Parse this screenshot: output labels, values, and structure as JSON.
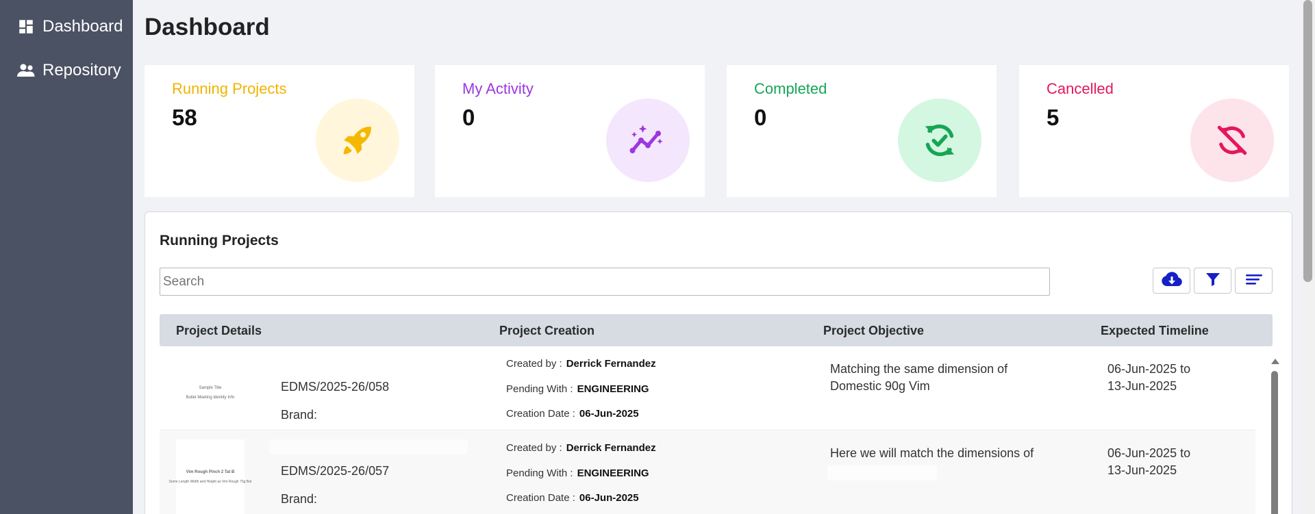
{
  "sidebar": {
    "items": [
      {
        "label": "Dashboard",
        "icon": "dashboard-icon"
      },
      {
        "label": "Repository",
        "icon": "people-icon"
      }
    ]
  },
  "page": {
    "title": "Dashboard"
  },
  "cards": [
    {
      "label": "Running Projects",
      "value": "58",
      "color": "#f0b400",
      "bg": "#fff6dc",
      "icon": "rocket-icon"
    },
    {
      "label": "My Activity",
      "value": "0",
      "color": "#9b37e0",
      "bg": "#f4e6fd",
      "icon": "trend-sparkle-icon"
    },
    {
      "label": "Completed",
      "value": "0",
      "color": "#17a556",
      "bg": "#d3f7e1",
      "icon": "sync-check-icon"
    },
    {
      "label": "Cancelled",
      "value": "5",
      "color": "#e4175f",
      "bg": "#fde3ea",
      "icon": "sync-off-icon"
    }
  ],
  "panel": {
    "title": "Running Projects",
    "search_placeholder": "Search",
    "toolbar": {
      "download": "cloud-download-icon",
      "filter": "filter-icon",
      "sort": "sort-lines-icon",
      "color": "#1520c7"
    },
    "columns": [
      "Project Details",
      "Project Creation",
      "Project Objective",
      "Expected Timeline"
    ],
    "rows": [
      {
        "thumb_lines": [
          "Sample Title",
          "Bullet Meeting Identity Info"
        ],
        "project_id": "EDMS/2025-26/058",
        "brand": "Brand:",
        "created_by_label": "Created by :",
        "created_by": "Derrick Fernandez",
        "pending_label": "Pending With :",
        "pending_with": "ENGINEERING",
        "date_label": "Creation Date :",
        "creation_date": "06-Jun-2025",
        "objective": "Matching the same dimension of Domestic 90g Vim",
        "timeline": "06-Jun-2025 to 13-Jun-2025"
      },
      {
        "thumb_lines": [
          "Vim Rough Pinch 2 Tat B",
          "Some Length Width and Height as Vim Rough 75g Bar"
        ],
        "project_id": "EDMS/2025-26/057",
        "brand": "Brand:",
        "created_by_label": "Created by :",
        "created_by": "Derrick Fernandez",
        "pending_label": "Pending With :",
        "pending_with": "ENGINEERING",
        "date_label": "Creation Date :",
        "creation_date": "06-Jun-2025",
        "objective": "Here we will match the dimensions of",
        "timeline": "06-Jun-2025 to 13-Jun-2025"
      }
    ]
  }
}
